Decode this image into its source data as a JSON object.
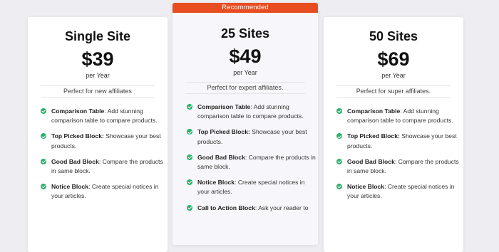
{
  "plans": [
    {
      "name": "Single Site",
      "price": "$39",
      "period": "per Year",
      "tagline": "Perfect for new affiliates",
      "features": [
        {
          "title": "Comparison Table",
          "sep": ": ",
          "text": "Add stunning comparison table to compare products."
        },
        {
          "title": "Top Picked Block:",
          "sep": " ",
          "text": "Showcase your best products."
        },
        {
          "title": "Good Bad Block",
          "sep": ": ",
          "text": "Compare the products in same block."
        },
        {
          "title": "Notice Block",
          "sep": ": ",
          "text": "Create special notices in your articles."
        }
      ]
    },
    {
      "badge": "Recommended",
      "name": "25 Sites",
      "price": "$49",
      "period": "per Year",
      "tagline": "Perfect for expert affiliates.",
      "features": [
        {
          "title": "Comparison Table",
          "sep": ": ",
          "text": "Add stunning comparison table to compare products."
        },
        {
          "title": "Top Picked Block:",
          "sep": " ",
          "text": "Showcase your best products."
        },
        {
          "title": "Good Bad Block",
          "sep": ": ",
          "text": "Compare the products in same block."
        },
        {
          "title": "Notice Block",
          "sep": ": ",
          "text": "Create special notices in your articles."
        },
        {
          "title": "Call to Action Block",
          "sep": ": ",
          "text": "Ask your reader to"
        }
      ]
    },
    {
      "name": "50 Sites",
      "price": "$69",
      "period": "per Year",
      "tagline": "Perfect for super affiliates.",
      "features": [
        {
          "title": "Comparison Table",
          "sep": ": ",
          "text": "Add stunning comparison table to compare products."
        },
        {
          "title": "Top Picked Block:",
          "sep": " ",
          "text": "Showcase your best products."
        },
        {
          "title": "Good Bad Block",
          "sep": ": ",
          "text": "Compare the products in same block."
        },
        {
          "title": "Notice Block",
          "sep": ": ",
          "text": "Create special notices in your articles."
        }
      ]
    }
  ],
  "colors": {
    "badge": "#e84d22",
    "check": "#2ab26b",
    "background": "#eeeef2"
  },
  "icons": {
    "feature_bullet": "check-circle-icon"
  }
}
